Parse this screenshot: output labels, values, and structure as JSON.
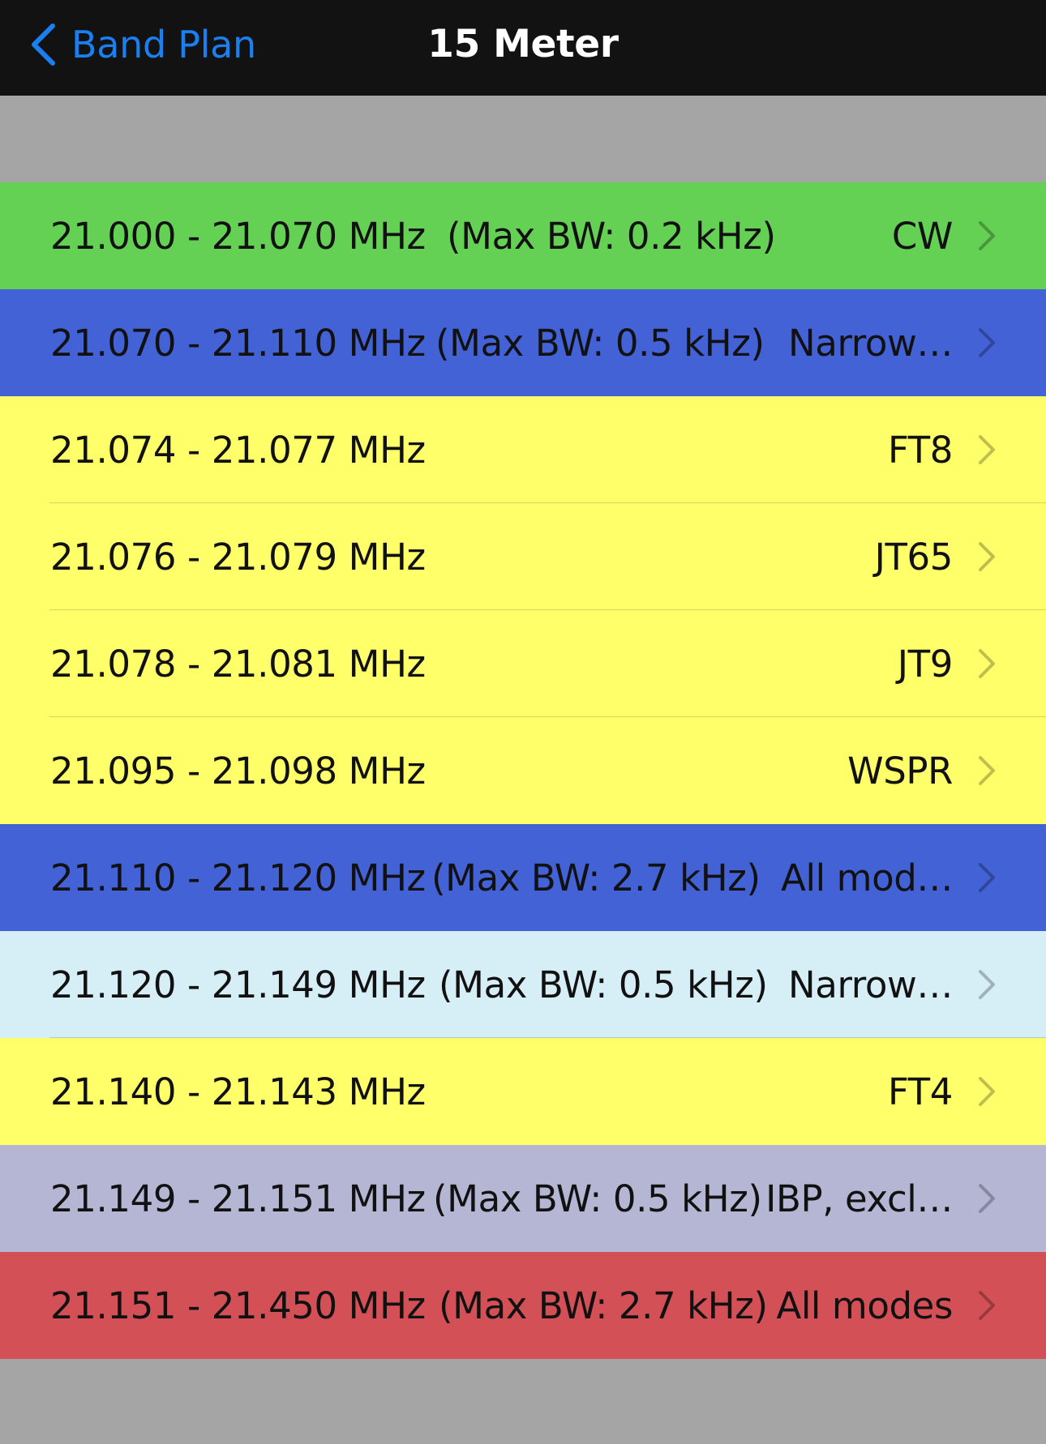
{
  "navbar": {
    "back_label": "Band Plan",
    "title": "15 Meter",
    "back_icon": "chevron-left-icon"
  },
  "colors": {
    "cw": "#65d154",
    "narrow_blue": "#4362d6",
    "digital_yellow": "#ffff6a",
    "light_blue": "#d6eef6",
    "ibp_lavender": "#b4b6d4",
    "all_modes_red": "#d35156",
    "background_gray": "#a5a5a5",
    "link_blue": "#1a7ff0"
  },
  "rows": [
    {
      "freq": "21.000 - 21.070 MHz",
      "bw": "(Max BW: 0.2 kHz)",
      "mode": "CW",
      "color": "#65d154"
    },
    {
      "freq": "21.070 - 21.110 MHz",
      "bw": "(Max BW: 0.5 kHz)",
      "mode": "Narrow…",
      "color": "#4362d6"
    },
    {
      "freq": "21.074 - 21.077 MHz",
      "bw": "",
      "mode": "FT8",
      "color": "#ffff6a"
    },
    {
      "freq": "21.076 - 21.079 MHz",
      "bw": "",
      "mode": "JT65",
      "color": "#ffff6a"
    },
    {
      "freq": "21.078 - 21.081 MHz",
      "bw": "",
      "mode": "JT9",
      "color": "#ffff6a"
    },
    {
      "freq": "21.095 - 21.098 MHz",
      "bw": "",
      "mode": "WSPR",
      "color": "#ffff6a"
    },
    {
      "freq": "21.110 - 21.120 MHz",
      "bw": "(Max BW: 2.7 kHz)",
      "mode": "All mod…",
      "color": "#4362d6"
    },
    {
      "freq": "21.120 - 21.149 MHz",
      "bw": "(Max BW: 0.5 kHz)",
      "mode": "Narrow…",
      "color": "#d6eef6"
    },
    {
      "freq": "21.140 - 21.143 MHz",
      "bw": "",
      "mode": "FT4",
      "color": "#ffff6a"
    },
    {
      "freq": "21.149 - 21.151 MHz",
      "bw": "(Max BW: 0.5 kHz)",
      "mode": "IBP, excl…",
      "color": "#b4b6d4"
    },
    {
      "freq": "21.151 - 21.450 MHz",
      "bw": "(Max BW: 2.7 kHz)",
      "mode": "All modes",
      "color": "#d35156"
    }
  ]
}
